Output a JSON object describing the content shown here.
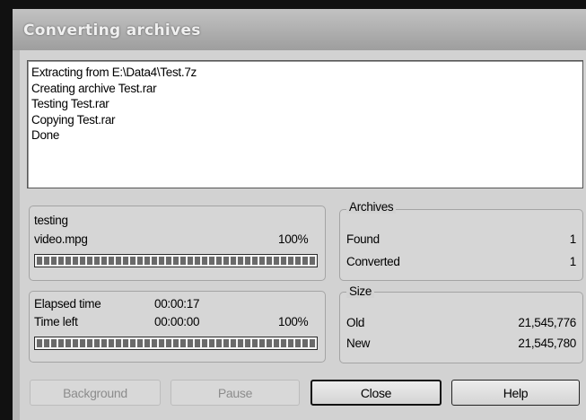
{
  "window": {
    "title": "Converting archives"
  },
  "log": {
    "lines": [
      "Extracting from E:\\Data4\\Test.7z",
      "Creating archive Test.rar",
      "Testing Test.rar",
      "Copying Test.rar",
      "Done"
    ]
  },
  "current": {
    "action": "testing",
    "file": "video.mpg",
    "percent_label": "100%",
    "progress": 1.0
  },
  "timing": {
    "elapsed_label": "Elapsed time",
    "elapsed_value": "00:00:17",
    "left_label": "Time left",
    "left_value": "00:00:00",
    "percent_label": "100%",
    "progress": 1.0
  },
  "archives": {
    "title": "Archives",
    "found_label": "Found",
    "found_value": "1",
    "converted_label": "Converted",
    "converted_value": "1"
  },
  "size": {
    "title": "Size",
    "old_label": "Old",
    "old_value": "21,545,776",
    "new_label": "New",
    "new_value": "21,545,780"
  },
  "buttons": {
    "background": "Background",
    "pause": "Pause",
    "close": "Close",
    "help": "Help"
  }
}
